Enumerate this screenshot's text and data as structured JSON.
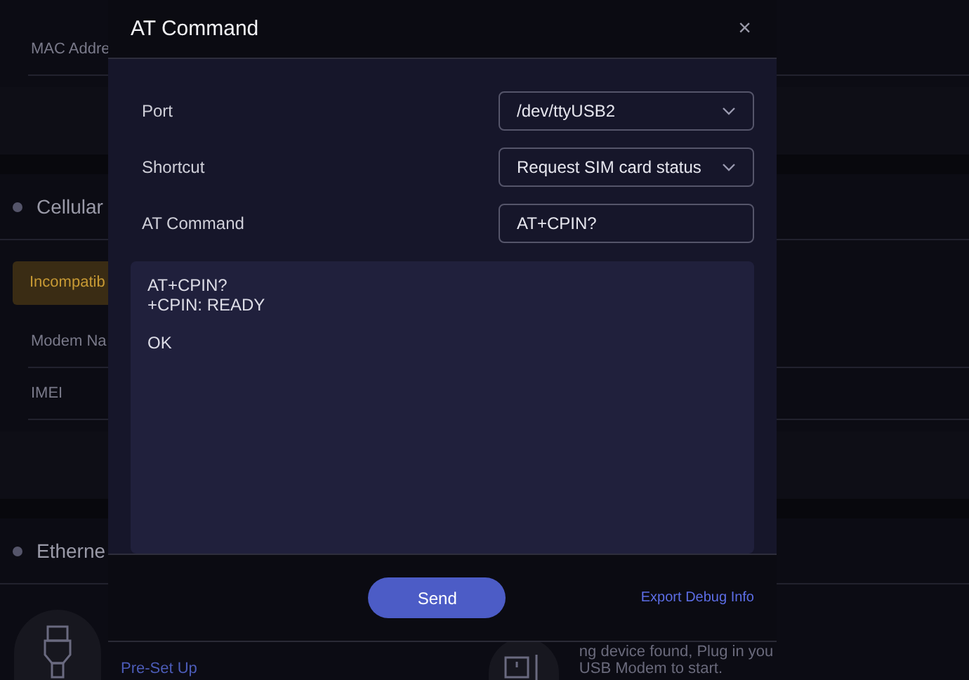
{
  "background": {
    "info_rows": [
      {
        "label": "MAC Addre"
      }
    ],
    "sections": [
      {
        "title": "Cellular",
        "badge": "Incompatib",
        "rows": [
          {
            "label": "Modem Na"
          },
          {
            "label": "IMEI"
          }
        ]
      },
      {
        "title": "Etherne"
      }
    ],
    "link": "Pre-Set Up",
    "message_lines": [
      "ng device found, Plug in you",
      "USB Modem to start."
    ]
  },
  "dialog": {
    "title": "AT Command",
    "close": "×",
    "fields": [
      {
        "kind": "select",
        "label": "Port",
        "value": "/dev/ttyUSB2"
      },
      {
        "kind": "select",
        "label": "Shortcut",
        "value": "Request SIM card status"
      },
      {
        "kind": "input",
        "label": "AT Command",
        "value": "AT+CPIN?"
      }
    ],
    "output_blocks": [
      {
        "lines": [
          "AT+CPIN?",
          "+CPIN: READY"
        ]
      },
      {
        "lines": [
          "OK"
        ]
      }
    ],
    "buttons": {
      "send": "Send",
      "export": "Export Debug Info"
    }
  }
}
